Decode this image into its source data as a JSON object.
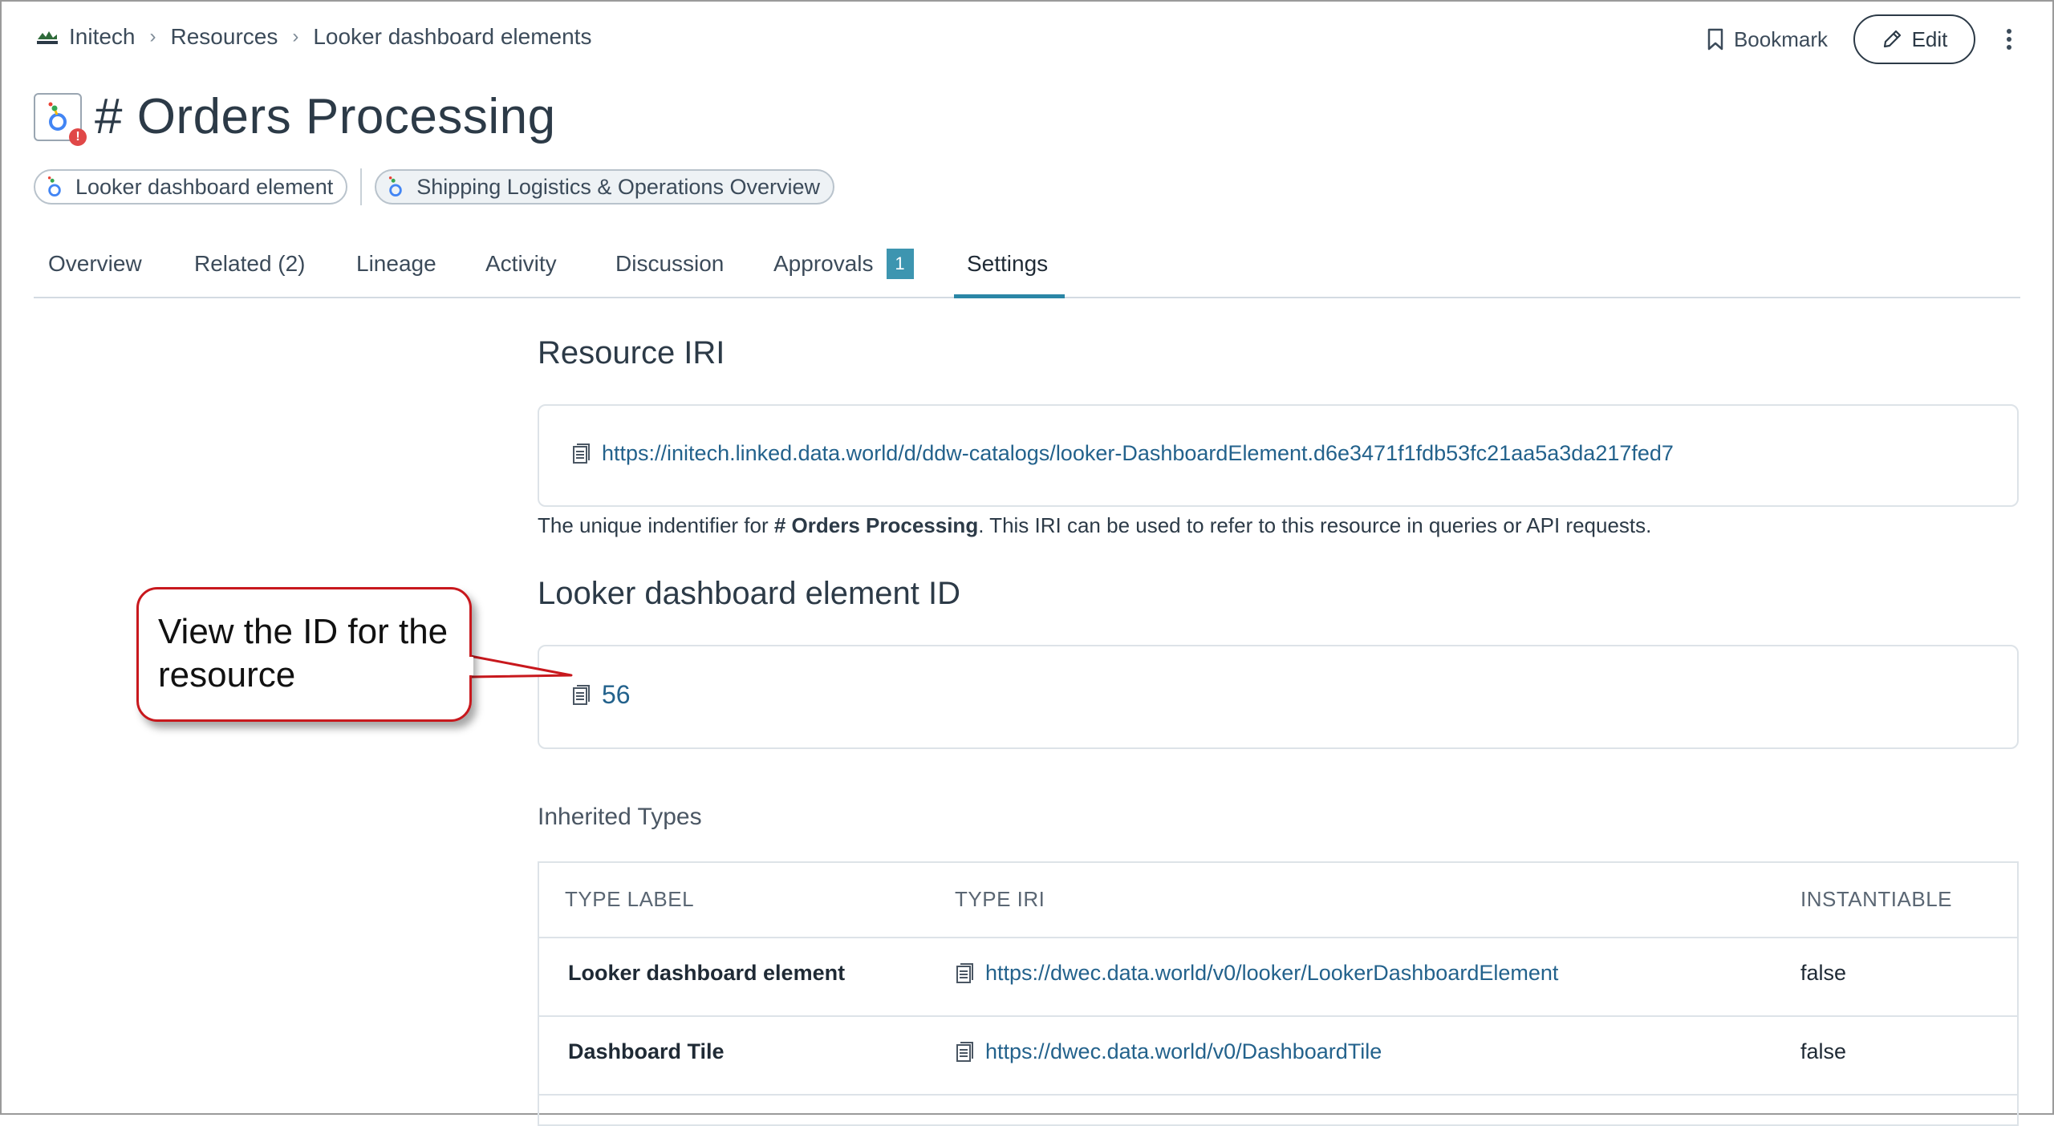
{
  "breadcrumb": {
    "org": "Initech",
    "section": "Resources",
    "page": "Looker dashboard elements"
  },
  "actions": {
    "bookmark": "Bookmark",
    "edit": "Edit"
  },
  "title": "# Orders Processing",
  "chips": {
    "type": "Looker dashboard element",
    "parent": "Shipping Logistics & Operations Overview"
  },
  "tabs": [
    {
      "label": "Overview"
    },
    {
      "label": "Related (2)"
    },
    {
      "label": "Lineage"
    },
    {
      "label": "Activity"
    },
    {
      "label": "Discussion"
    },
    {
      "label": "Approvals",
      "badge": "1"
    },
    {
      "label": "Settings",
      "active": true
    }
  ],
  "resource_iri": {
    "heading": "Resource IRI",
    "url": "https://initech.linked.data.world/d/ddw-catalogs/looker-DashboardElement.d6e3471f1fdb53fc21aa5a3da217fed7",
    "desc_prefix": "The unique indentifier for ",
    "desc_name": "# Orders Processing",
    "desc_suffix": ". This IRI can be used to refer to this resource in queries or API requests."
  },
  "element_id": {
    "heading": "Looker dashboard element ID",
    "value": "56"
  },
  "inherited": {
    "heading": "Inherited Types",
    "columns": [
      "TYPE LABEL",
      "TYPE IRI",
      "INSTANTIABLE"
    ],
    "rows": [
      {
        "label": "Looker dashboard element",
        "iri": "https://dwec.data.world/v0/looker/LookerDashboardElement",
        "instantiable": "false"
      },
      {
        "label": "Dashboard Tile",
        "iri": "https://dwec.data.world/v0/DashboardTile",
        "instantiable": "false"
      }
    ]
  },
  "callout": {
    "text": "View the ID for the resource"
  },
  "colors": {
    "link": "#23628c",
    "accent": "#2a86a6",
    "badge": "#3d95b0",
    "callout_border": "#c8181d",
    "alert": "#e04848"
  }
}
